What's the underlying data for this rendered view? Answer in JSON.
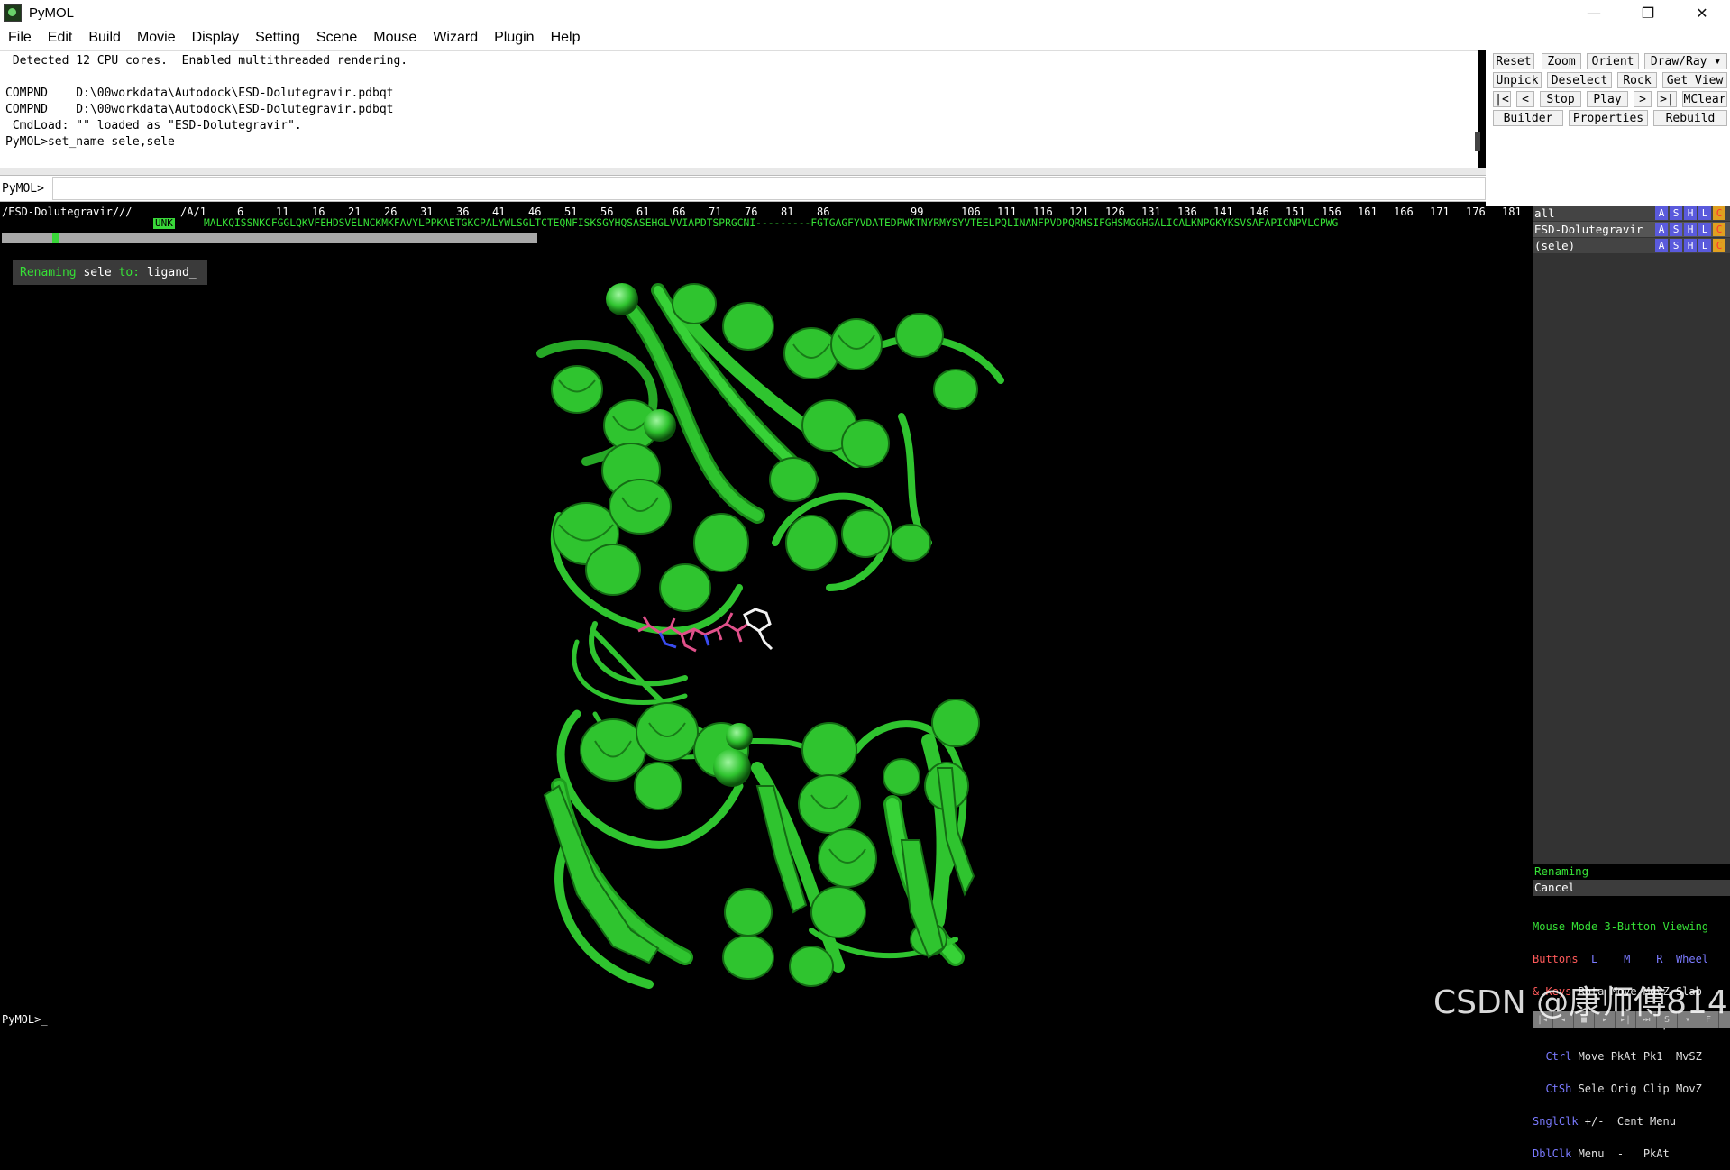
{
  "window": {
    "title": "PyMOL",
    "minimize": "—",
    "maximize": "❐",
    "close": "✕"
  },
  "menu": [
    "File",
    "Edit",
    "Build",
    "Movie",
    "Display",
    "Setting",
    "Scene",
    "Mouse",
    "Wizard",
    "Plugin",
    "Help"
  ],
  "output_lines": [
    " Detected 12 CPU cores.  Enabled multithreaded rendering.",
    "",
    "COMPND    D:\\00workdata\\Autodock\\ESD-Dolutegravir.pdbqt",
    "COMPND    D:\\00workdata\\Autodock\\ESD-Dolutegravir.pdbqt",
    " CmdLoad: \"\" loaded as \"ESD-Dolutegravir\".",
    "PyMOL>set_name sele,sele"
  ],
  "cmd": {
    "prompt": "PyMOL>",
    "value": ""
  },
  "buttons": {
    "row1": [
      "Reset",
      "Zoom",
      "Orient",
      "Draw/Ray ▾"
    ],
    "row2": [
      "Unpick",
      "Deselect",
      "Rock",
      "Get View"
    ],
    "row3": [
      "|<",
      "<",
      "Stop",
      "Play",
      ">",
      ">|",
      "MClear"
    ],
    "row4": [
      "Builder",
      "Properties",
      "Rebuild"
    ]
  },
  "sequence": {
    "object": "/ESD-Dolutegravir///",
    "chain": "/A/1",
    "numbers": [
      "6",
      "11",
      "16",
      "21",
      "26",
      "31",
      "36",
      "41",
      "46",
      "51",
      "56",
      "61",
      "66",
      "71",
      "76",
      "81",
      "86",
      "99",
      "106",
      "111",
      "116",
      "121",
      "126",
      "131",
      "136",
      "141",
      "146",
      "151",
      "156",
      "161",
      "166",
      "171",
      "176",
      "181"
    ],
    "unk": "UNK",
    "residues": "MALKQISSNKCFGGLQKVFEHDSVELNCKMKFAVYLPPKAETGKCPALYWLSGLTCTEQNFISKSGYHQSASEHGLVVIAPDTSPRGCNI---------FGTGAGFYVDATEDPWKTNYRMYSYVTEELPQLINANFPVDPQRMSIFGHSMGGHGALICALKNPGKYKSVSAFAPICNPVLCPWG"
  },
  "wizard_prompt": {
    "word1": "Renaming",
    "word2": "sele",
    "word3": "to:",
    "word4": "ligand_"
  },
  "objects": [
    {
      "name": "all",
      "buttons": [
        "A",
        "S",
        "H",
        "L",
        "C"
      ]
    },
    {
      "name": "ESD-Dolutegravir",
      "buttons": [
        "A",
        "S",
        "H",
        "L",
        "C"
      ]
    },
    {
      "name": "(sele)",
      "buttons": [
        "A",
        "S",
        "H",
        "L",
        "C"
      ]
    }
  ],
  "wizard_panel": {
    "title": "Renaming",
    "cancel": "Cancel"
  },
  "mouse": {
    "line1a": "Mouse Mode",
    "line1b": " 3-Button Viewing",
    "line2a": "Buttons",
    "line2b": "  L    M    R  Wheel",
    "lines": [
      {
        "k": "& Keys",
        "v": " Rota Move MovZ Slab"
      },
      {
        "k": "  Shft",
        "v": " +Box -Box Clip MovS"
      },
      {
        "k": "  Ctrl",
        "v": " Move PkAt Pk1  MvSZ"
      },
      {
        "k": "  CtSh",
        "v": " Sele Orig Clip MovZ"
      },
      {
        "k": "SnglClk",
        "v": " +/-  Cent Menu"
      },
      {
        "k": "DblClk",
        "v": " Menu  -   PkAt"
      }
    ]
  },
  "bottom_prompt": "PyMOL>_",
  "movie_controls": [
    "|◂",
    "◂",
    "■",
    "▸",
    "▸|",
    "⏭",
    "S",
    "▾",
    "F"
  ],
  "watermark": "CSDN @康师傅814",
  "colors": {
    "protein": "#2fc42f",
    "sequence": "#36e036",
    "ligand_pink": "#e0508a"
  }
}
